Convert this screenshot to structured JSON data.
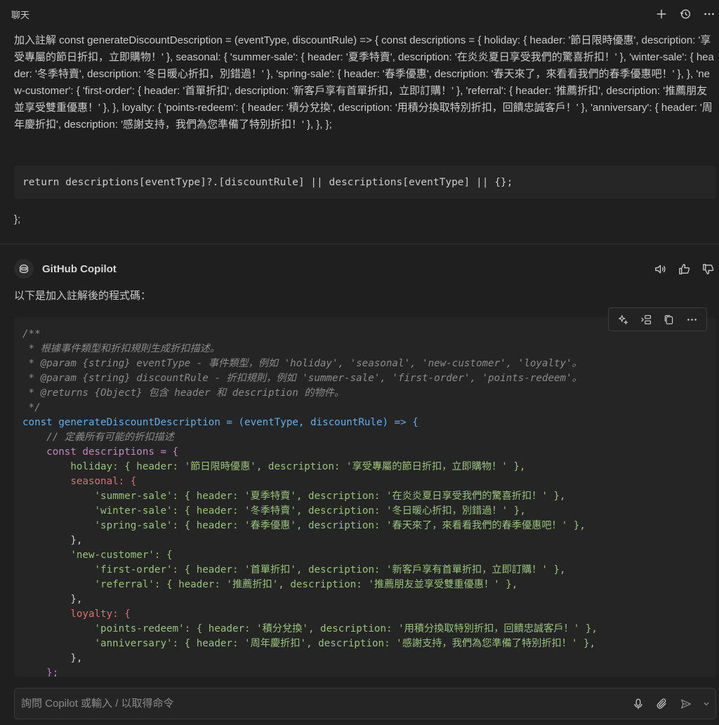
{
  "header": {
    "title": "聊天",
    "icons": [
      "plus-icon",
      "history-icon",
      "more-icon"
    ]
  },
  "request": {
    "text": "加入註解 const generateDiscountDescription = (eventType, discountRule) => { const descriptions = { holiday: { header: '節日限時優惠', description: '享受專屬的節日折扣，立即購物！' }, seasonal: { 'summer-sale': { header: '夏季特賣', description: '在炎炎夏日享受我們的驚喜折扣！' }, 'winter-sale': { header: '冬季特賣', description: '冬日暖心折扣，別錯過！' }, 'spring-sale': { header: '春季優惠', description: '春天來了，來看看我們的春季優惠吧！' }, }, 'new-customer': { 'first-order': { header: '首單折扣', description: '新客戶享有首單折扣，立即訂購！' }, 'referral': { header: '推薦折扣', description: '推薦朋友並享受雙重優惠！' }, }, loyalty: { 'points-redeem': { header: '積分兌換', description: '用積分換取特別折扣，回饋忠誠客戶！' }, 'anniversary': { header: '周年慶折扣', description: '感謝支持，我們為您準備了特別折扣！' }, }, };",
    "code_line": "return descriptions[eventType]?.[discountRule] || descriptions[eventType] || {};",
    "closing": "};"
  },
  "response": {
    "author": "GitHub Copilot",
    "intro": "以下是加入註解後的程式碼：",
    "icons": [
      "speaker-icon",
      "thumbs-up-icon",
      "thumbs-down-icon"
    ],
    "code_toolbar_icons": [
      "sparkle-icon",
      "insert-icon",
      "copy-icon",
      "more-icon"
    ],
    "code_lines": [
      "/**",
      " * 根據事件類型和折扣規則生成折扣描述。",
      " * @param {string} eventType - 事件類型，例如 'holiday', 'seasonal', 'new-customer', 'loyalty'。",
      " * @param {string} discountRule - 折扣規則，例如 'summer-sale', 'first-order', 'points-redeem'。",
      " * @returns {Object} 包含 header 和 description 的物件。",
      " */",
      "const generateDiscountDescription = (eventType, discountRule) => {",
      "    // 定義所有可能的折扣描述",
      "    const descriptions = {",
      "        holiday: { header: '節日限時優惠', description: '享受專屬的節日折扣，立即購物！' },",
      "        seasonal: {",
      "            'summer-sale': { header: '夏季特賣', description: '在炎炎夏日享受我們的驚喜折扣！' },",
      "            'winter-sale': { header: '冬季特賣', description: '冬日暖心折扣，別錯過！' },",
      "            'spring-sale': { header: '春季優惠', description: '春天來了，來看看我們的春季優惠吧！' },",
      "        },",
      "        'new-customer': {",
      "            'first-order': { header: '首單折扣', description: '新客戶享有首單折扣，立即訂購！' },",
      "            'referral': { header: '推薦折扣', description: '推薦朋友並享受雙重優惠！' },",
      "        },",
      "        loyalty: {",
      "            'points-redeem': { header: '積分兌換', description: '用積分換取特別折扣，回饋忠誠客戶！' },",
      "            'anniversary': { header: '周年慶折扣', description: '感謝支持，我們為您準備了特別折扣！' },",
      "        },",
      "    };"
    ]
  },
  "input": {
    "placeholder": "詢問 Copilot 或輸入 / 以取得命令",
    "icons": [
      "microphone-icon",
      "attach-icon",
      "send-icon",
      "chevron-down-icon"
    ]
  }
}
